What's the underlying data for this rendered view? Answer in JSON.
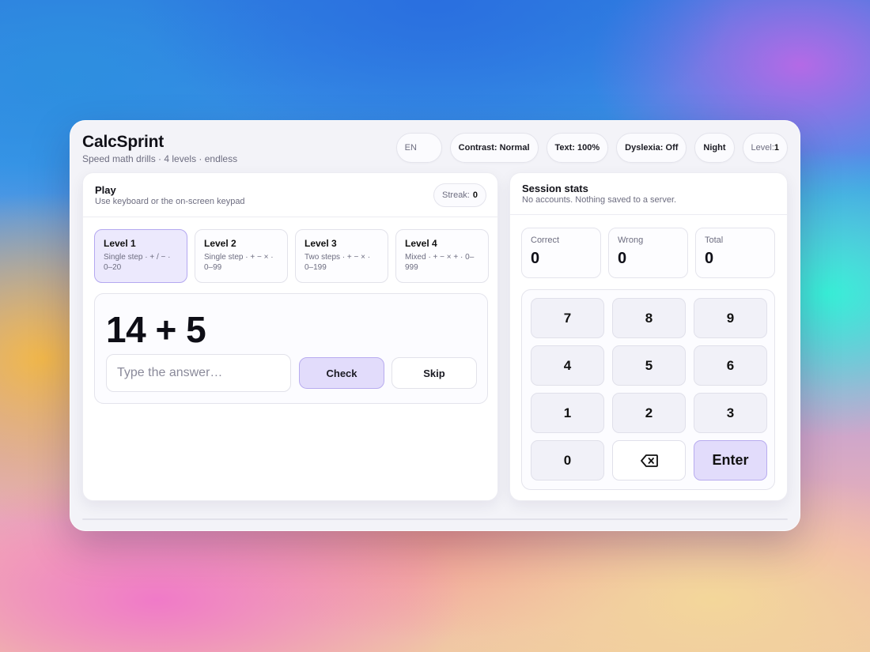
{
  "app": {
    "title": "CalcSprint",
    "subtitle": "Speed math drills · 4 levels · endless"
  },
  "toolbar": {
    "language": "EN",
    "contrast": "Contrast: Normal",
    "text_size": "Text: 100%",
    "dyslexia": "Dyslexia: Off",
    "theme": "Night",
    "level_label": "Level:",
    "level_value": "1"
  },
  "play": {
    "title": "Play",
    "subtitle": "Use keyboard or the on-screen keypad",
    "streak_label": "Streak:",
    "streak_value": "0",
    "levels": [
      {
        "name": "Level 1",
        "desc": "Single step · + / − · 0–20",
        "active": true
      },
      {
        "name": "Level 2",
        "desc": "Single step · + − × · 0–99",
        "active": false
      },
      {
        "name": "Level 3",
        "desc": "Two steps · + − × · 0–199",
        "active": false
      },
      {
        "name": "Level 4",
        "desc": "Mixed · + − × + · 0–999",
        "active": false
      }
    ],
    "problem": "14 + 5",
    "answer_placeholder": "Type the answer…",
    "check_label": "Check",
    "skip_label": "Skip"
  },
  "stats": {
    "title": "Session stats",
    "subtitle": "No accounts. Nothing saved to a server.",
    "correct_label": "Correct",
    "correct_value": "0",
    "wrong_label": "Wrong",
    "wrong_value": "0",
    "total_label": "Total",
    "total_value": "0"
  },
  "keypad": {
    "keys": [
      "7",
      "8",
      "9",
      "4",
      "5",
      "6",
      "1",
      "2",
      "3",
      "0"
    ],
    "backspace_icon": "backspace-icon",
    "enter_label": "Enter"
  },
  "colors": {
    "accent_bg": "#e2dcfb",
    "accent_border": "#b8acef",
    "active_level_bg": "#ece9fd"
  }
}
